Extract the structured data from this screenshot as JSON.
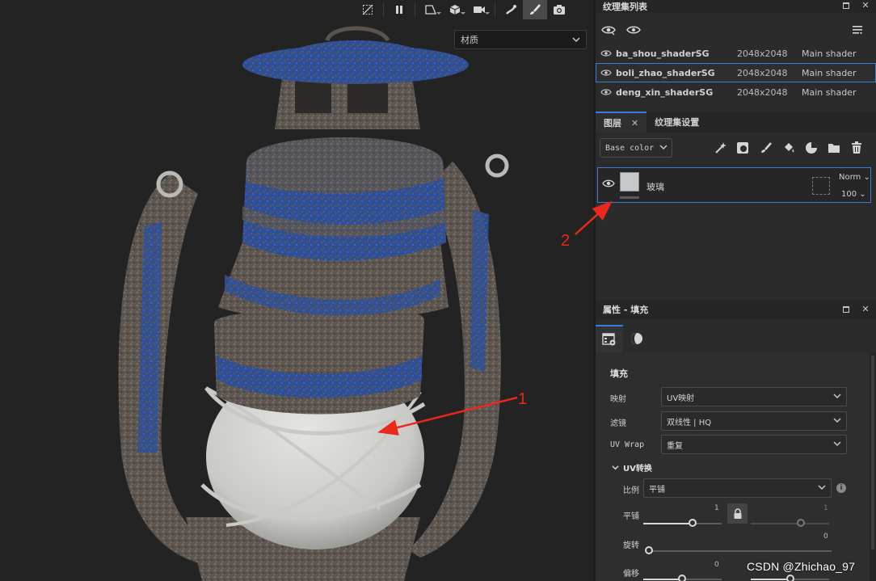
{
  "viewport": {
    "material_label": "材质",
    "toolbar": [
      "hide-ui-icon",
      "pause-icon",
      "camera-view-icon",
      "cube-icon",
      "video-icon",
      "brush-stroke-icon",
      "paintbrush-icon",
      "screenshot-icon"
    ]
  },
  "texture_sets": {
    "title": "纹理集列表",
    "rows": [
      {
        "name": "ba_shou_shaderSG",
        "resolution": "2048x2048",
        "shader": "Main shader",
        "selected": false
      },
      {
        "name": "boli_zhao_shaderSG",
        "resolution": "2048x2048",
        "shader": "Main shader",
        "selected": true
      },
      {
        "name": "deng_xin_shaderSG",
        "resolution": "2048x2048",
        "shader": "Main shader",
        "selected": false
      }
    ]
  },
  "layers": {
    "tab_layers": "图层",
    "tab_settings": "纹理集设置",
    "channel": "Base color",
    "layer": {
      "name": "玻璃",
      "blend": "Norm",
      "opacity": "100"
    }
  },
  "properties": {
    "title": "属性 - 填充",
    "section": "填充",
    "mapping_label": "映射",
    "mapping_value": "UV映射",
    "filter_label": "滤镜",
    "filter_value": "双线性 | HQ",
    "wrap_label": "UV Wrap",
    "wrap_value": "重复",
    "uv_transform": "UV转换",
    "scale_label": "比例",
    "scale_value": "平铺",
    "tile_label": "平铺",
    "tile_value_1": "1",
    "tile_value_2": "1",
    "rotate_label": "旋转",
    "rotate_value": "0",
    "offset_label": "偏移",
    "offset_value": "0"
  },
  "annotations": {
    "one": "1",
    "two": "2"
  },
  "watermark": "CSDN @Zhichao_97",
  "colors": {
    "accent": "#3a7bd5",
    "annotation": "#e8291c",
    "lantern_blue": "#2b4e9a"
  }
}
